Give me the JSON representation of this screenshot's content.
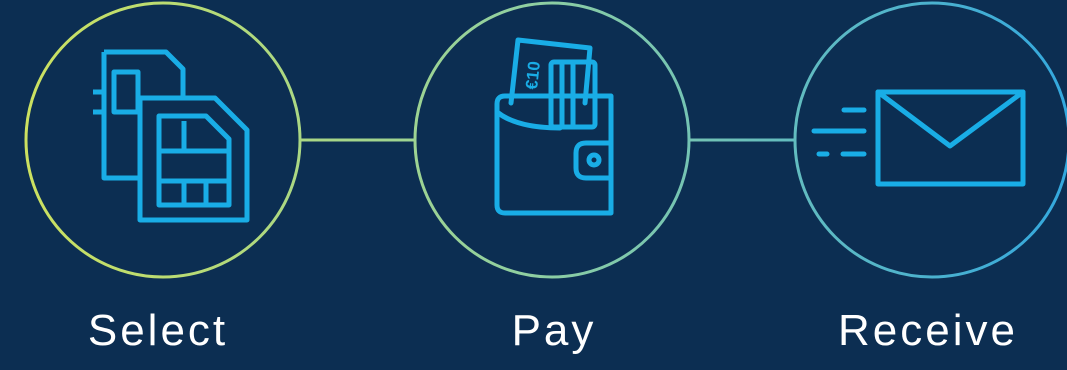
{
  "colors": {
    "background": "#0c2e52",
    "icon": "#19ade6",
    "ring_start": "#cfe25d",
    "ring_end": "#34a8de",
    "label": "#ffffff"
  },
  "steps": [
    {
      "label": "Select",
      "icon": "sim-card-icon"
    },
    {
      "label": "Pay",
      "icon": "wallet-icon"
    },
    {
      "label": "Receive",
      "icon": "envelope-icon"
    }
  ],
  "wallet": {
    "banknote_text": "€10"
  }
}
